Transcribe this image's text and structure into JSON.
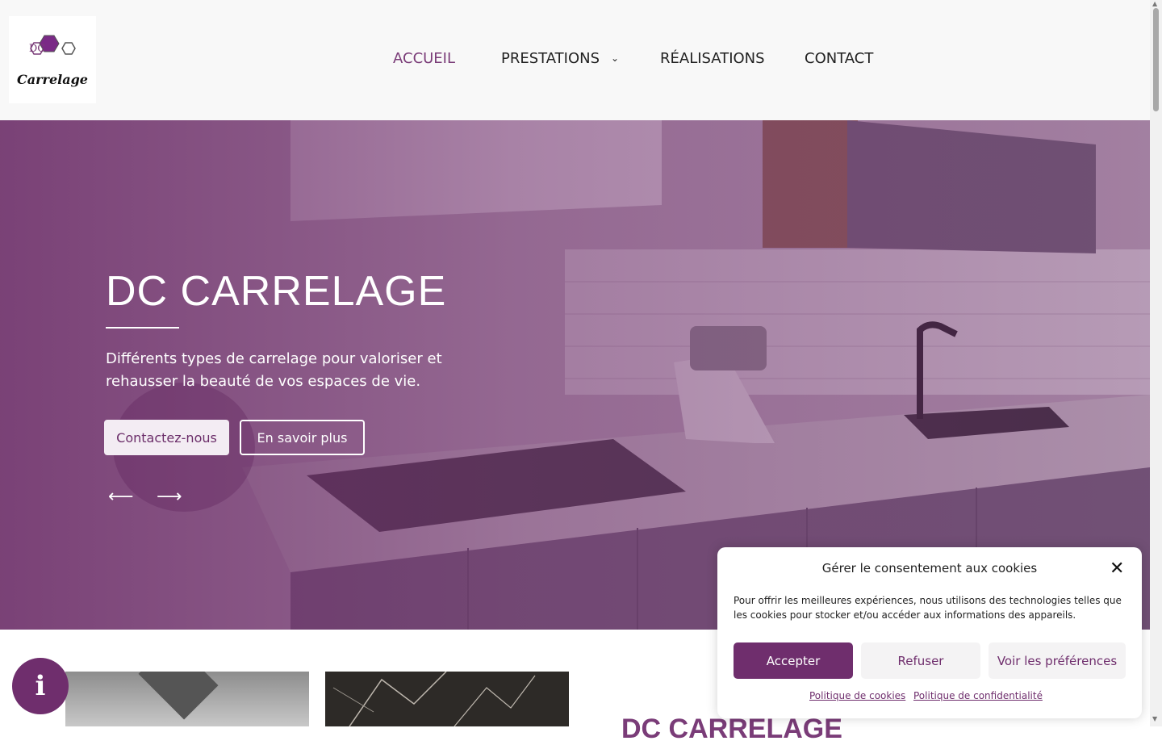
{
  "header": {
    "logo_text": "Carrelage",
    "logo_letters": "DC",
    "nav": [
      {
        "label": "ACCUEIL",
        "active": true
      },
      {
        "label": "PRESTATIONS",
        "has_dropdown": true
      },
      {
        "label": "RÉALISATIONS"
      },
      {
        "label": "CONTACT"
      }
    ]
  },
  "hero": {
    "title": "DC CARRELAGE",
    "description": "Différents types de carrelage pour valoriser et rehausser la beauté de vos espaces de vie.",
    "primary_button": "Contactez-nous",
    "secondary_button": "En savoir plus",
    "prev_icon": "arrow-left-icon",
    "next_icon": "arrow-right-icon"
  },
  "content": {
    "section_title": "DC CARRELAGE"
  },
  "info_button": {
    "icon": "info-icon"
  },
  "cookie_banner": {
    "title": "Gérer le consentement aux cookies",
    "text": "Pour offrir les meilleures expériences, nous utilisons des technologies telles que les cookies pour stocker et/ou accéder aux informations des appareils.",
    "accept": "Accepter",
    "refuse": "Refuser",
    "preferences": "Voir les préférences",
    "cookie_policy": "Politique de cookies",
    "privacy_policy": "Politique de confidentialité"
  },
  "colors": {
    "accent": "#6f2e6d",
    "header_bg": "#f8f8f8"
  }
}
